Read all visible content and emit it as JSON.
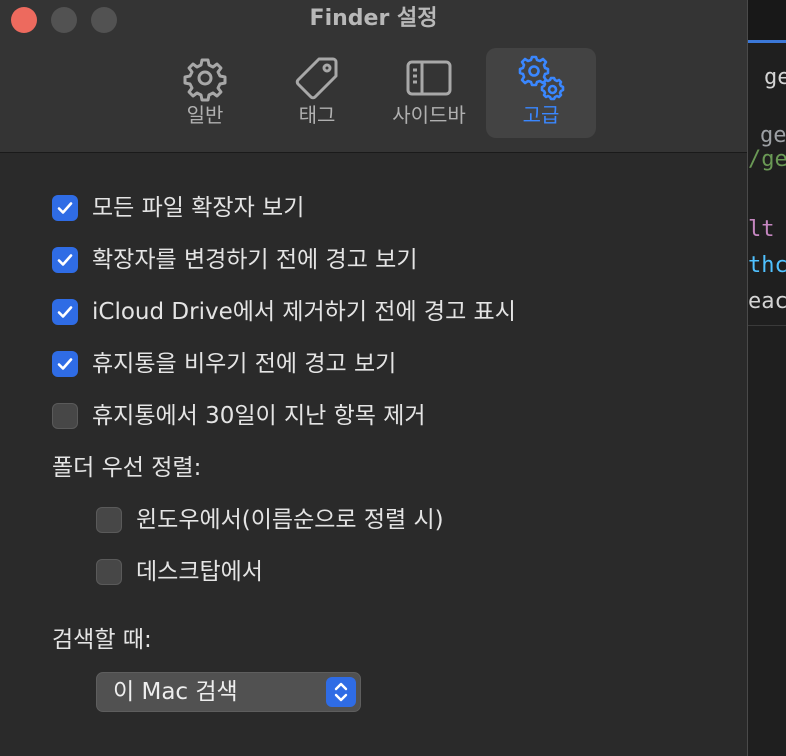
{
  "window": {
    "title": "Finder 설정"
  },
  "tabs": [
    {
      "label": "일반",
      "icon": "gear-icon"
    },
    {
      "label": "태그",
      "icon": "tag-icon"
    },
    {
      "label": "사이드바",
      "icon": "sidebar-icon"
    },
    {
      "label": "고급",
      "icon": "gears-icon",
      "selected": true
    }
  ],
  "options": [
    {
      "label": "모든 파일 확장자 보기",
      "checked": true
    },
    {
      "label": "확장자를 변경하기 전에 경고 보기",
      "checked": true
    },
    {
      "label": "iCloud Drive에서 제거하기 전에 경고 표시",
      "checked": true
    },
    {
      "label": "휴지통을 비우기 전에 경고 보기",
      "checked": true
    },
    {
      "label": "휴지통에서 30일이 지난 항목 제거",
      "checked": false
    }
  ],
  "folders_first": {
    "label": "폴더 우선 정렬:",
    "options": [
      {
        "label": "윈도우에서(이름순으로 정렬 시)",
        "checked": false
      },
      {
        "label": "데스크탑에서",
        "checked": false
      }
    ]
  },
  "search": {
    "label": "검색할 때:",
    "value": "이 Mac 검색"
  },
  "background_editor": {
    "lines": [
      "ge",
      "ge",
      "/ge",
      "lt",
      "thc",
      "eac"
    ]
  },
  "colors": {
    "accent": "#2f6ce5",
    "selected_tab_text": "#3a87ff",
    "close_button": "#ed6a5e"
  }
}
